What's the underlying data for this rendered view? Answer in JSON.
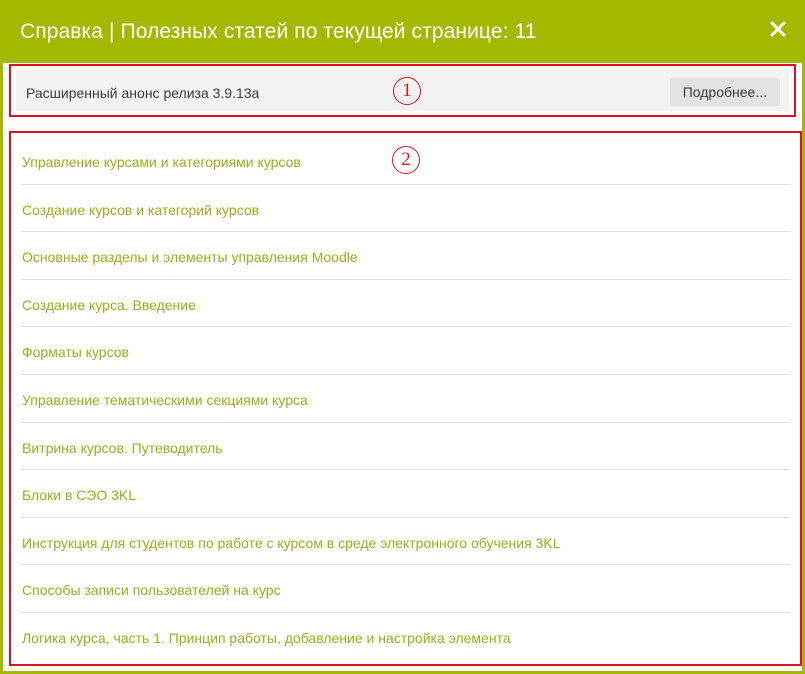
{
  "dialog": {
    "title": "Справка | Полезных статей по текущей странице: 11",
    "close_icon": "close-icon",
    "accent_color": "#a3b800"
  },
  "release": {
    "text": "Расширенный анонс релиза 3.9.13а",
    "details_label": "Подробнее..."
  },
  "callouts": [
    "1",
    "2"
  ],
  "articles": [
    {
      "label": "Управление курсами и категориями курсов"
    },
    {
      "label": "Создание курсов и категорий курсов"
    },
    {
      "label": "Основные разделы и элементы управления Moodle"
    },
    {
      "label": "Создание курса. Введение"
    },
    {
      "label": "Форматы курсов"
    },
    {
      "label": "Управление тематическими секциями курса"
    },
    {
      "label": "Витрина курсов. Путеводитель"
    },
    {
      "label": "Блоки в  СЭО 3KL"
    },
    {
      "label": "Инструкция для студентов по работе с курсом в среде электронного обучения 3KL"
    },
    {
      "label": "Способы записи пользователей на курс"
    },
    {
      "label": "Логика курса, часть 1. Принцип работы, добавление и настройка элемента"
    }
  ],
  "colors": {
    "link": "#99ae1a",
    "highlight_border": "#e0121f"
  }
}
